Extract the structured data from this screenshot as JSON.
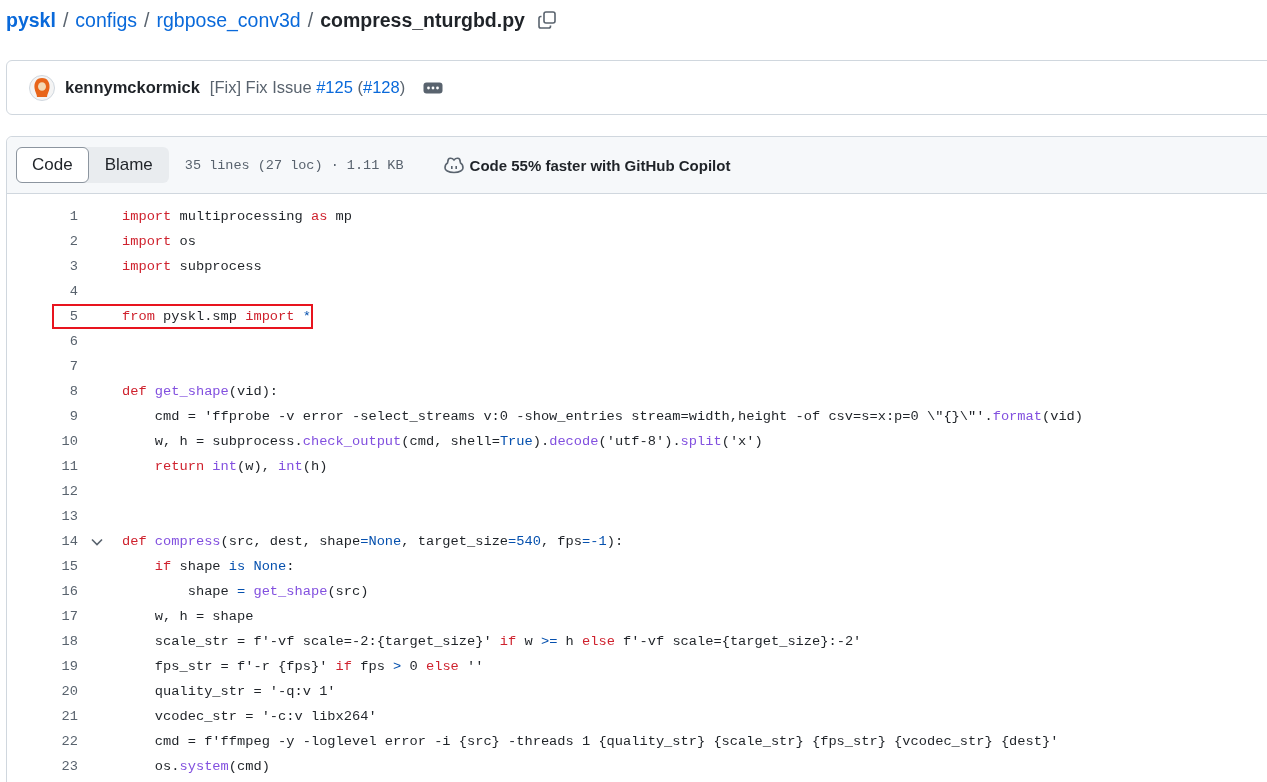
{
  "breadcrumb": {
    "separator": "/",
    "parts": [
      {
        "text": "pyskl",
        "kind": "repo"
      },
      {
        "text": "configs",
        "kind": "folder"
      },
      {
        "text": "rgbpose_conv3d",
        "kind": "folder"
      },
      {
        "text": "compress_nturgbd.py",
        "kind": "file"
      }
    ]
  },
  "commit": {
    "author": "kennymckormick",
    "message": [
      {
        "text": "[Fix] Fix Issue ",
        "link": false
      },
      {
        "text": "#125",
        "link": true
      },
      {
        "text": " (",
        "link": false
      },
      {
        "text": "#128",
        "link": true
      },
      {
        "text": ")",
        "link": false
      }
    ]
  },
  "file_header": {
    "tabs": [
      {
        "label": "Code",
        "selected": true
      },
      {
        "label": "Blame",
        "selected": false
      }
    ],
    "stats": "35 lines (27 loc) · 1.11 KB",
    "copilot": "Code 55% faster with GitHub Copilot"
  },
  "code": {
    "lines": [
      {
        "number": "1",
        "tokens": [
          {
            "kind": "keyword",
            "text": "import"
          },
          {
            "kind": "plain",
            "text": " multiprocessing "
          },
          {
            "kind": "keyword",
            "text": "as"
          },
          {
            "kind": "plain",
            "text": " mp"
          }
        ]
      },
      {
        "number": "2",
        "tokens": [
          {
            "kind": "keyword",
            "text": "import"
          },
          {
            "kind": "plain",
            "text": " os"
          }
        ]
      },
      {
        "number": "3",
        "tokens": [
          {
            "kind": "keyword",
            "text": "import"
          },
          {
            "kind": "plain",
            "text": " subprocess"
          }
        ]
      },
      {
        "number": "4"
      },
      {
        "number": "5",
        "highlighted": true,
        "tokens": [
          {
            "kind": "keyword",
            "text": "from"
          },
          {
            "kind": "plain",
            "text": " pyskl.smp "
          },
          {
            "kind": "keyword",
            "text": "import"
          },
          {
            "kind": "constant",
            "text": " *"
          }
        ]
      },
      {
        "number": "6"
      },
      {
        "number": "7"
      },
      {
        "number": "8",
        "tokens": [
          {
            "kind": "keyword",
            "text": "def "
          },
          {
            "kind": "function",
            "text": "get_shape"
          },
          {
            "kind": "plain",
            "text": "(vid):"
          }
        ]
      },
      {
        "number": "9",
        "tokens": [
          {
            "kind": "plain",
            "text": "    cmd = 'ffprobe -v error -select_streams v:0 -show_entries stream=width,height -of csv=s=x:p=0 \\\"{}\\\"'."
          },
          {
            "kind": "function",
            "text": "format"
          },
          {
            "kind": "plain",
            "text": "(vid)"
          }
        ]
      },
      {
        "number": "10",
        "tokens": [
          {
            "kind": "plain",
            "text": "    w, h = subprocess."
          },
          {
            "kind": "function",
            "text": "check_output"
          },
          {
            "kind": "plain",
            "text": "(cmd, shell="
          },
          {
            "kind": "constant",
            "text": "True"
          },
          {
            "kind": "plain",
            "text": ")."
          },
          {
            "kind": "function",
            "text": "decode"
          },
          {
            "kind": "plain",
            "text": "('utf-8')."
          },
          {
            "kind": "function",
            "text": "split"
          },
          {
            "kind": "plain",
            "text": "('x')"
          }
        ]
      },
      {
        "number": "11",
        "tokens": [
          {
            "kind": "keyword",
            "text": "    return "
          },
          {
            "kind": "function",
            "text": "int"
          },
          {
            "kind": "plain",
            "text": "(w), "
          },
          {
            "kind": "function",
            "text": "int"
          },
          {
            "kind": "plain",
            "text": "(h)"
          }
        ]
      },
      {
        "number": "12"
      },
      {
        "number": "13"
      },
      {
        "number": "14",
        "expanded": true,
        "tokens": [
          {
            "kind": "keyword",
            "text": "def "
          },
          {
            "kind": "function",
            "text": "compress"
          },
          {
            "kind": "plain",
            "text": "(src, dest, shape"
          },
          {
            "kind": "constant",
            "text": "=None"
          },
          {
            "kind": "plain",
            "text": ", target_size"
          },
          {
            "kind": "constant",
            "text": "=540"
          },
          {
            "kind": "plain",
            "text": ", fps"
          },
          {
            "kind": "constant",
            "text": "=-1"
          },
          {
            "kind": "plain",
            "text": "):"
          }
        ]
      },
      {
        "number": "15",
        "tokens": [
          {
            "kind": "keyword",
            "text": "    if"
          },
          {
            "kind": "plain",
            "text": " shape "
          },
          {
            "kind": "constant",
            "text": "is None"
          },
          {
            "kind": "plain",
            "text": ":"
          }
        ]
      },
      {
        "number": "16",
        "tokens": [
          {
            "kind": "plain",
            "text": "        shape "
          },
          {
            "kind": "constant",
            "text": "= "
          },
          {
            "kind": "function",
            "text": "get_shape"
          },
          {
            "kind": "plain",
            "text": "(src)"
          }
        ]
      },
      {
        "number": "17",
        "tokens": [
          {
            "kind": "plain",
            "text": "    w, h = shape"
          }
        ]
      },
      {
        "number": "18",
        "tokens": [
          {
            "kind": "plain",
            "text": "    scale_str = f'-vf scale=-2:{target_size}' "
          },
          {
            "kind": "keyword",
            "text": "if"
          },
          {
            "kind": "plain",
            "text": " w "
          },
          {
            "kind": "constant",
            "text": ">="
          },
          {
            "kind": "plain",
            "text": " h "
          },
          {
            "kind": "keyword",
            "text": "else"
          },
          {
            "kind": "plain",
            "text": " f'-vf scale={target_size}:-2'"
          }
        ]
      },
      {
        "number": "19",
        "tokens": [
          {
            "kind": "plain",
            "text": "    fps_str = f'-r {fps}' "
          },
          {
            "kind": "keyword",
            "text": "if"
          },
          {
            "kind": "plain",
            "text": " fps "
          },
          {
            "kind": "constant",
            "text": ">"
          },
          {
            "kind": "plain",
            "text": " 0 "
          },
          {
            "kind": "keyword",
            "text": "else"
          },
          {
            "kind": "plain",
            "text": " ''"
          }
        ]
      },
      {
        "number": "20",
        "tokens": [
          {
            "kind": "plain",
            "text": "    quality_str = '-q:v 1'"
          }
        ]
      },
      {
        "number": "21",
        "tokens": [
          {
            "kind": "plain",
            "text": "    vcodec_str = '-c:v libx264'"
          }
        ]
      },
      {
        "number": "22",
        "tokens": [
          {
            "kind": "plain",
            "text": "    cmd = f'ffmpeg -y -loglevel error -i {src} -threads 1 {quality_str} {scale_str} {fps_str} {vcodec_str} {dest}'"
          }
        ]
      },
      {
        "number": "23",
        "tokens": [
          {
            "kind": "plain",
            "text": "    os."
          },
          {
            "kind": "function",
            "text": "system"
          },
          {
            "kind": "plain",
            "text": "(cmd)"
          }
        ]
      }
    ]
  }
}
